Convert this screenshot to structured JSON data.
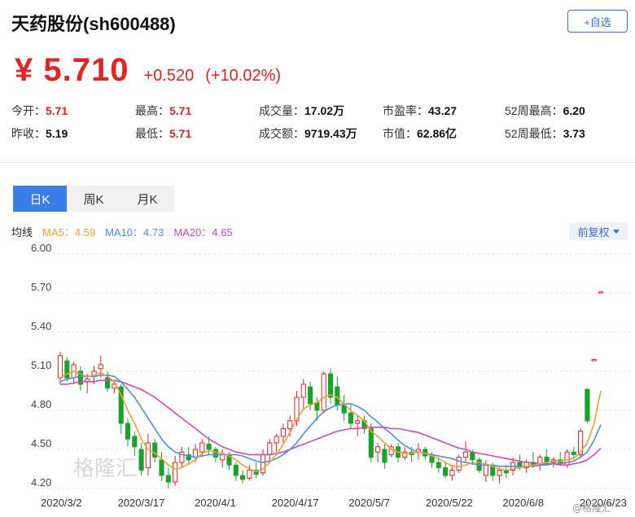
{
  "header": {
    "title": "天药股份(sh600488)",
    "add_label": "+自选"
  },
  "quote": {
    "price": "¥ 5.710",
    "change": "+0.520",
    "change_pct": "(+10.02%)"
  },
  "stats": {
    "row1": [
      {
        "label": "今开：",
        "value": "5.71",
        "red": true
      },
      {
        "label": "最高：",
        "value": "5.71",
        "red": true
      },
      {
        "label": "成交量：",
        "value": "17.02万",
        "red": false
      },
      {
        "label": "市盈率：",
        "value": "43.27",
        "red": false
      },
      {
        "label": "52周最高：",
        "value": "6.20",
        "red": false
      }
    ],
    "row2": [
      {
        "label": "昨收：",
        "value": "5.19",
        "red": false
      },
      {
        "label": "最低：",
        "value": "5.71",
        "red": true
      },
      {
        "label": "成交额：",
        "value": "9719.43万",
        "red": false
      },
      {
        "label": "市值：",
        "value": "62.86亿",
        "red": false
      },
      {
        "label": "52周最低：",
        "value": "3.73",
        "red": false
      }
    ]
  },
  "tabs": [
    {
      "label": "日K",
      "active": true
    },
    {
      "label": "周K",
      "active": false
    },
    {
      "label": "月K",
      "active": false
    }
  ],
  "ma": {
    "label": "均线",
    "ma5": "MA5：4.59",
    "ma10": "MA10：4.73",
    "ma20": "MA20：4.65"
  },
  "adjust_label": "前复权",
  "watermark": {
    "main": "格隆汇",
    "corner": "@格隆汇"
  },
  "colors": {
    "up": "#e62222",
    "down": "#1aa32b",
    "ma5": "#f0a030",
    "ma10": "#4a8ee6",
    "ma20": "#d946b8",
    "accent": "#3b7de8"
  },
  "chart_data": {
    "type": "candlestick",
    "y_ticks": [
      "6.00",
      "5.70",
      "5.40",
      "5.10",
      "4.80",
      "4.50",
      "4.20"
    ],
    "ylim": [
      4.2,
      6.0
    ],
    "x_labels": [
      "2020/3/2",
      "2020/3/17",
      "2020/4/1",
      "2020/4/17",
      "2020/5/7",
      "2020/5/22",
      "2020/6/8",
      "2020/6/23"
    ],
    "candles": [
      [
        5.05,
        5.25,
        5.0,
        5.22
      ],
      [
        5.18,
        5.21,
        5.02,
        5.05
      ],
      [
        5.05,
        5.17,
        5.0,
        5.15
      ],
      [
        5.1,
        5.14,
        4.95,
        5.0
      ],
      [
        5.02,
        5.08,
        4.93,
        5.04
      ],
      [
        5.06,
        5.14,
        5.0,
        5.1
      ],
      [
        5.12,
        5.22,
        5.05,
        5.15
      ],
      [
        5.05,
        5.1,
        4.94,
        4.97
      ],
      [
        4.97,
        5.03,
        4.93,
        5.0
      ],
      [
        4.98,
        5.0,
        4.62,
        4.7
      ],
      [
        4.7,
        4.74,
        4.52,
        4.58
      ],
      [
        4.6,
        4.64,
        4.45,
        4.52
      ],
      [
        4.5,
        4.55,
        4.3,
        4.34
      ],
      [
        4.36,
        4.62,
        4.3,
        4.55
      ],
      [
        4.55,
        4.58,
        4.4,
        4.44
      ],
      [
        4.42,
        4.48,
        4.26,
        4.3
      ],
      [
        4.3,
        4.36,
        4.2,
        4.25
      ],
      [
        4.25,
        4.45,
        4.22,
        4.4
      ],
      [
        4.4,
        4.52,
        4.36,
        4.48
      ],
      [
        4.46,
        4.52,
        4.38,
        4.42
      ],
      [
        4.44,
        4.54,
        4.4,
        4.5
      ],
      [
        4.48,
        4.58,
        4.44,
        4.55
      ],
      [
        4.54,
        4.6,
        4.46,
        4.5
      ],
      [
        4.5,
        4.52,
        4.4,
        4.44
      ],
      [
        4.42,
        4.5,
        4.36,
        4.46
      ],
      [
        4.46,
        4.48,
        4.34,
        4.38
      ],
      [
        4.38,
        4.4,
        4.26,
        4.3
      ],
      [
        4.3,
        4.34,
        4.24,
        4.27
      ],
      [
        4.28,
        4.38,
        4.26,
        4.34
      ],
      [
        4.34,
        4.4,
        4.28,
        4.31
      ],
      [
        4.32,
        4.5,
        4.3,
        4.46
      ],
      [
        4.46,
        4.58,
        4.4,
        4.55
      ],
      [
        4.55,
        4.62,
        4.48,
        4.6
      ],
      [
        4.6,
        4.7,
        4.55,
        4.66
      ],
      [
        4.66,
        4.76,
        4.6,
        4.72
      ],
      [
        4.72,
        4.95,
        4.68,
        4.9
      ],
      [
        4.9,
        5.04,
        4.8,
        5.0
      ],
      [
        4.98,
        5.02,
        4.8,
        4.85
      ],
      [
        4.86,
        4.9,
        4.72,
        4.8
      ],
      [
        4.8,
        5.1,
        4.78,
        5.08
      ],
      [
        5.08,
        5.12,
        4.85,
        4.9
      ],
      [
        4.98,
        5.06,
        4.8,
        4.84
      ],
      [
        4.84,
        4.92,
        4.72,
        4.78
      ],
      [
        4.78,
        4.85,
        4.66,
        4.7
      ],
      [
        4.7,
        4.76,
        4.6,
        4.72
      ],
      [
        4.72,
        4.76,
        4.62,
        4.66
      ],
      [
        4.66,
        4.7,
        4.4,
        4.44
      ],
      [
        4.48,
        4.55,
        4.4,
        4.52
      ],
      [
        4.5,
        4.54,
        4.35,
        4.4
      ],
      [
        4.46,
        4.54,
        4.44,
        4.52
      ],
      [
        4.52,
        4.55,
        4.4,
        4.44
      ],
      [
        4.44,
        4.52,
        4.42,
        4.48
      ],
      [
        4.48,
        4.52,
        4.4,
        4.46
      ],
      [
        4.48,
        4.55,
        4.42,
        4.5
      ],
      [
        4.5,
        4.52,
        4.42,
        4.45
      ],
      [
        4.45,
        4.48,
        4.36,
        4.4
      ],
      [
        4.4,
        4.44,
        4.32,
        4.36
      ],
      [
        4.36,
        4.4,
        4.28,
        4.3
      ],
      [
        4.3,
        4.38,
        4.26,
        4.34
      ],
      [
        4.34,
        4.46,
        4.32,
        4.44
      ],
      [
        4.44,
        4.56,
        4.4,
        4.48
      ],
      [
        4.48,
        4.5,
        4.38,
        4.42
      ],
      [
        4.42,
        4.44,
        4.32,
        4.34
      ],
      [
        4.3,
        4.42,
        4.25,
        4.38
      ],
      [
        4.38,
        4.4,
        4.26,
        4.3
      ],
      [
        4.3,
        4.36,
        4.24,
        4.34
      ],
      [
        4.34,
        4.38,
        4.28,
        4.32
      ],
      [
        4.34,
        4.44,
        4.3,
        4.4
      ],
      [
        4.4,
        4.46,
        4.34,
        4.36
      ],
      [
        4.36,
        4.42,
        4.32,
        4.4
      ],
      [
        4.4,
        4.48,
        4.36,
        4.38
      ],
      [
        4.38,
        4.46,
        4.34,
        4.44
      ],
      [
        4.44,
        4.5,
        4.38,
        4.4
      ],
      [
        4.4,
        4.44,
        4.36,
        4.42
      ],
      [
        4.42,
        4.48,
        4.38,
        4.4
      ],
      [
        4.38,
        4.5,
        4.36,
        4.48
      ],
      [
        4.48,
        4.52,
        4.42,
        4.46
      ],
      [
        4.46,
        4.66,
        4.44,
        4.64
      ],
      [
        4.96,
        4.97,
        4.7,
        4.72
      ],
      [
        5.19,
        5.19,
        5.19,
        5.19
      ],
      [
        5.71,
        5.71,
        5.71,
        5.71
      ]
    ],
    "ma5": [
      5.05,
      5.08,
      5.1,
      5.08,
      5.06,
      5.07,
      5.09,
      5.06,
      5.02,
      4.92,
      4.8,
      4.7,
      4.58,
      4.5,
      4.47,
      4.43,
      4.38,
      4.35,
      4.36,
      4.39,
      4.42,
      4.47,
      4.49,
      4.48,
      4.47,
      4.45,
      4.42,
      4.38,
      4.35,
      4.33,
      4.35,
      4.4,
      4.46,
      4.54,
      4.63,
      4.73,
      4.81,
      4.84,
      4.86,
      4.9,
      4.92,
      4.9,
      4.85,
      4.8,
      4.76,
      4.72,
      4.64,
      4.6,
      4.55,
      4.5,
      4.48,
      4.47,
      4.47,
      4.48,
      4.47,
      4.45,
      4.43,
      4.4,
      4.37,
      4.37,
      4.38,
      4.4,
      4.4,
      4.39,
      4.37,
      4.35,
      4.34,
      4.35,
      4.36,
      4.37,
      4.38,
      4.39,
      4.4,
      4.41,
      4.41,
      4.42,
      4.43,
      4.48,
      4.55,
      4.7,
      4.95
    ],
    "ma10": [
      5.02,
      5.04,
      5.05,
      5.06,
      5.06,
      5.06,
      5.07,
      5.07,
      5.06,
      5.02,
      4.96,
      4.9,
      4.82,
      4.74,
      4.66,
      4.58,
      4.52,
      4.48,
      4.46,
      4.45,
      4.44,
      4.45,
      4.46,
      4.46,
      4.46,
      4.46,
      4.46,
      4.45,
      4.43,
      4.41,
      4.4,
      4.41,
      4.43,
      4.46,
      4.5,
      4.55,
      4.62,
      4.68,
      4.74,
      4.79,
      4.82,
      4.84,
      4.85,
      4.85,
      4.83,
      4.8,
      4.75,
      4.71,
      4.66,
      4.62,
      4.57,
      4.53,
      4.5,
      4.48,
      4.47,
      4.46,
      4.45,
      4.44,
      4.43,
      4.41,
      4.4,
      4.39,
      4.38,
      4.38,
      4.38,
      4.37,
      4.37,
      4.37,
      4.37,
      4.37,
      4.37,
      4.38,
      4.38,
      4.39,
      4.39,
      4.4,
      4.41,
      4.44,
      4.48,
      4.57,
      4.69
    ],
    "ma20": [
      5.0,
      5.0,
      5.01,
      5.02,
      5.02,
      5.02,
      5.03,
      5.03,
      5.03,
      5.02,
      5.0,
      4.98,
      4.96,
      4.93,
      4.9,
      4.86,
      4.82,
      4.78,
      4.74,
      4.7,
      4.66,
      4.62,
      4.58,
      4.55,
      4.52,
      4.5,
      4.48,
      4.47,
      4.46,
      4.46,
      4.46,
      4.46,
      4.47,
      4.48,
      4.5,
      4.52,
      4.54,
      4.56,
      4.58,
      4.6,
      4.62,
      4.64,
      4.65,
      4.66,
      4.66,
      4.67,
      4.67,
      4.67,
      4.67,
      4.66,
      4.66,
      4.65,
      4.64,
      4.63,
      4.61,
      4.59,
      4.57,
      4.55,
      4.53,
      4.51,
      4.5,
      4.48,
      4.47,
      4.46,
      4.45,
      4.44,
      4.43,
      4.42,
      4.41,
      4.4,
      4.4,
      4.39,
      4.39,
      4.39,
      4.38,
      4.38,
      4.39,
      4.4,
      4.42,
      4.46,
      4.51
    ]
  }
}
